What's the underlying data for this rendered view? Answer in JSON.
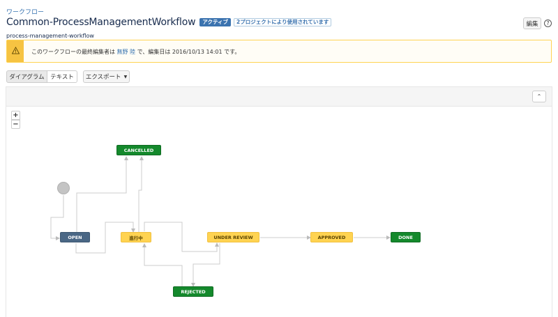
{
  "breadcrumb": "ワークフロー",
  "title": "Common-ProcessManagementWorkflow",
  "lozenge_active": "アクティブ",
  "lozenge_projects": "2プロジェクトにより使用されています",
  "subtitle": "process-management-workflow",
  "header": {
    "edit_label": "編集",
    "help_symbol": "?"
  },
  "warning": {
    "prefix": "このワークフローの最終編集者は",
    "user": "無野 陸",
    "suffix": "で、編集日は 2016/10/13 14:01 です。"
  },
  "view_tabs": {
    "diagram": "ダイアグラム",
    "text": "テキスト"
  },
  "export": {
    "label": "エクスポート",
    "caret": "▼"
  },
  "diagram": {
    "collapse_symbol": "⌃",
    "zoom_in": "+",
    "zoom_out": "−",
    "statuses": {
      "cancelled": "CANCELLED",
      "open": "OPEN",
      "in_progress": "進行中",
      "under_review": "UNDER REVIEW",
      "approved": "APPROVED",
      "done": "DONE",
      "rejected": "REJECTED"
    }
  },
  "colors": {
    "green": "#14892c",
    "blue": "#4a6785",
    "yellow": "#ffd351",
    "link": "#3572b0",
    "warning": "#f6c342"
  },
  "icons": [
    "warning-icon",
    "help-icon",
    "collapse-icon",
    "chevron-down-icon",
    "zoom-in-icon",
    "zoom-out-icon"
  ]
}
